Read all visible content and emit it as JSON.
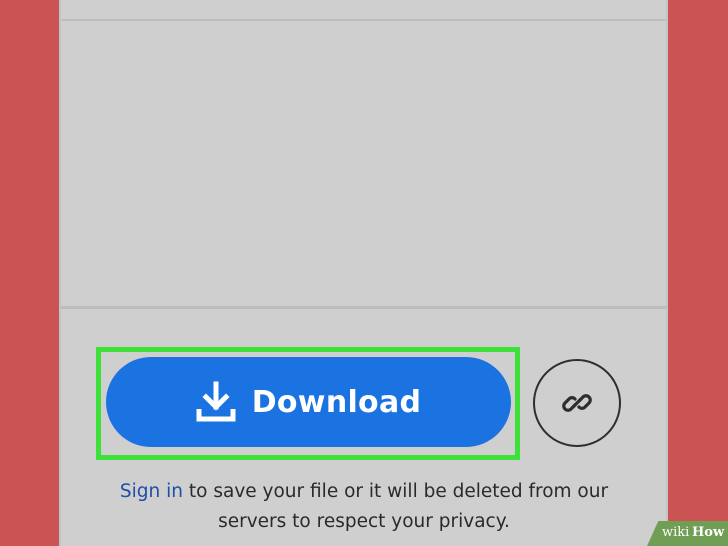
{
  "download_button": {
    "label": "Download",
    "icon": "download-icon"
  },
  "link_button": {
    "icon": "link-icon"
  },
  "notice": {
    "signin_link": "Sign in",
    "text": "to save your file or it will be deleted from our servers to respect your privacy."
  },
  "watermark": {
    "part1": "wiki",
    "part2": "How"
  },
  "colors": {
    "background": "#cc5353",
    "screen": "#cfcfcf",
    "button": "#1a73e0",
    "highlight": "#3ce23a",
    "link_text": "#1f4da8"
  }
}
